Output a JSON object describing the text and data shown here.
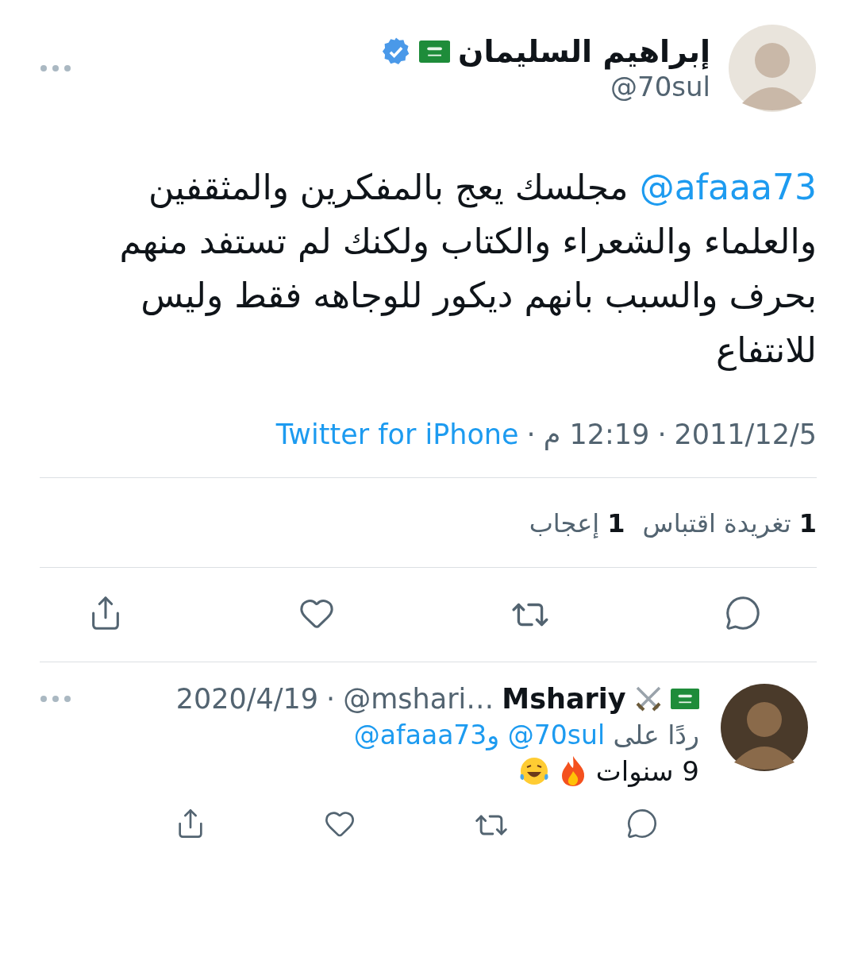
{
  "tweet": {
    "author": {
      "name": "إبراهيم السليمان",
      "handle": "@70sul",
      "verified": true
    },
    "body": {
      "mention": "@afaaa73",
      "text": " مجلسك يعج بالمفكرين والمثقفين والعلماء والشعراء والكتاب ولكنك لم تستفد منهم بحرف والسبب بانهم ديكور للوجاهه فقط وليس للانتفاع"
    },
    "meta": {
      "date": "2011/12/5",
      "time": "12:19 م",
      "source": "Twitter for iPhone",
      "separator": "·"
    },
    "stats": [
      {
        "count": "1",
        "label": "تغريدة اقتباس"
      },
      {
        "count": "1",
        "label": "إعجاب"
      }
    ]
  },
  "reply": {
    "author": {
      "name": "Mshariy",
      "handle": "@mshari…"
    },
    "date": "2020/4/19",
    "separator": "·",
    "replying_to": {
      "prefix": "ردًا على",
      "mentions": [
        "@70sul",
        "@afaaa73"
      ],
      "joiner": "و"
    },
    "text": "9 سنوات"
  }
}
